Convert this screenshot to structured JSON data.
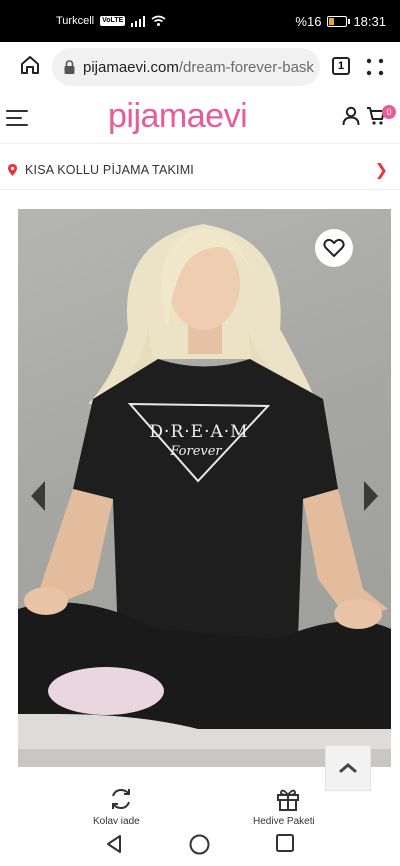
{
  "status_bar": {
    "carrier": "Turkcell",
    "network_badge": "VoLTE",
    "battery_text": "%16",
    "battery_level": 0.16,
    "time": "18:31"
  },
  "browser": {
    "url_domain": "pijamaevi.com",
    "url_path": "/dream-forever-bask",
    "tab_count": "1",
    "icons": [
      "home-icon",
      "lock-icon",
      "menu-dots-icon"
    ]
  },
  "site": {
    "logo_part1": "pijama",
    "logo_part2": "evi",
    "brand_color": "#e95a9b",
    "cart_count": "0",
    "icons": [
      "hamburger-icon",
      "user-icon",
      "cart-icon"
    ]
  },
  "breadcrumb": {
    "label": "KISA KOLLU PİJAMA TAKIMI",
    "chevron": "❯",
    "pin_color": "#e8363a"
  },
  "product_image": {
    "shirt_text_line1": "D·R·E·A·M",
    "shirt_text_line2": "Forever",
    "icons": [
      "heart-icon",
      "arrow-left-icon",
      "arrow-right-icon"
    ]
  },
  "action_bar": {
    "items": [
      {
        "icon": "exchange-icon",
        "label": "Kolay iade"
      },
      {
        "icon": "gift-icon",
        "label": "Hediye Paketi"
      }
    ],
    "scroll_top_icon": "chevron-up-icon"
  },
  "android_nav": {
    "icons": [
      "back-icon",
      "home-circle-icon",
      "recents-icon"
    ]
  }
}
